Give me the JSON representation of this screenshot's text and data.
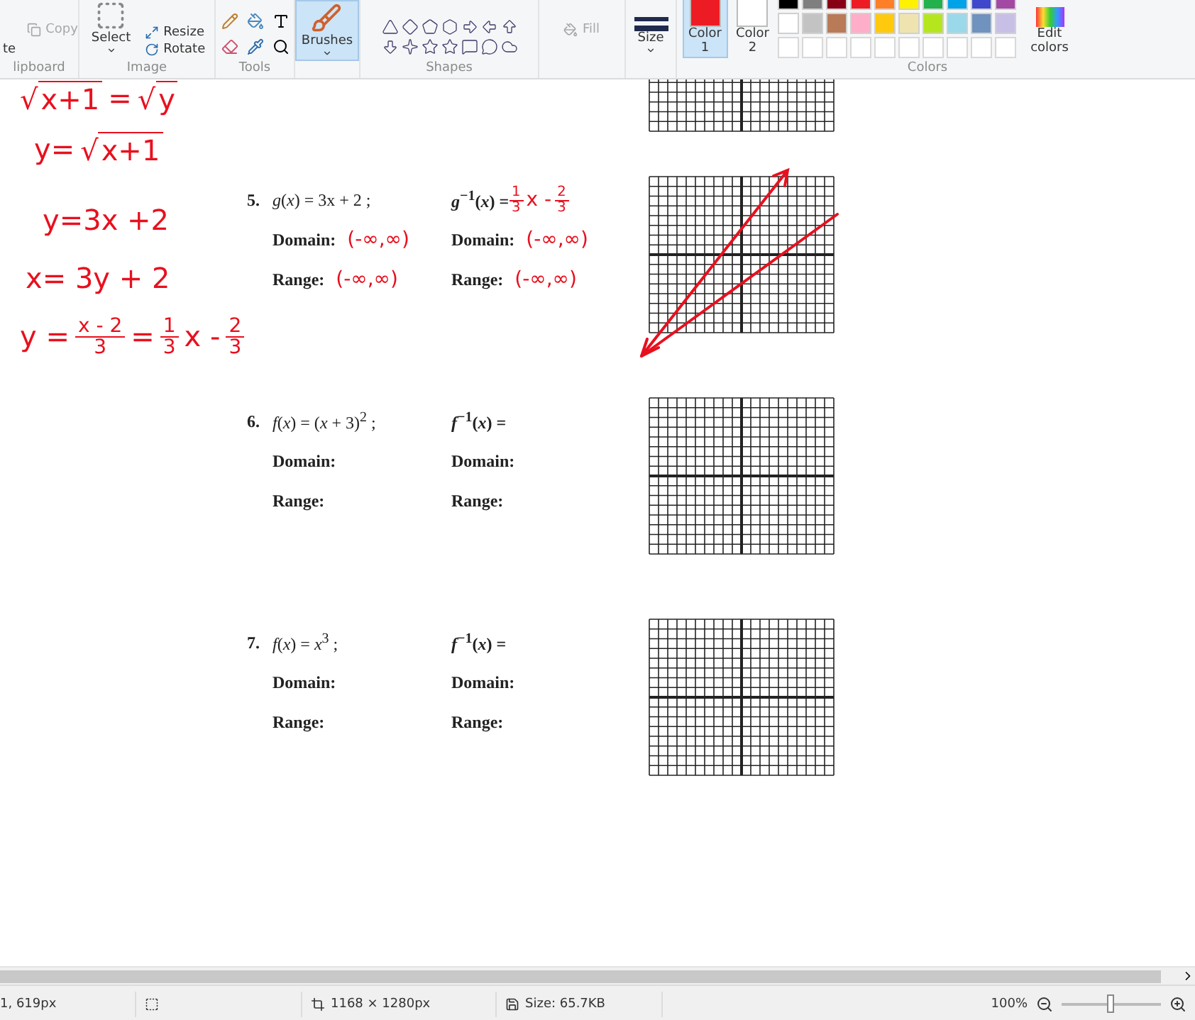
{
  "ribbon": {
    "groups": [
      {
        "kind": "clipboard",
        "label": "lipboard",
        "paste": "te",
        "items": [
          {
            "label": "Copy",
            "disabled": true
          }
        ]
      },
      {
        "kind": "image",
        "label": "Image",
        "select": "Select",
        "items": [
          {
            "label": "Resize",
            "disabled": false
          },
          {
            "label": "Rotate",
            "disabled": false
          }
        ]
      },
      {
        "kind": "tools",
        "label": "Tools"
      },
      {
        "kind": "brushes",
        "label": "Brushes",
        "selected": true
      },
      {
        "kind": "shapes",
        "label": "Shapes"
      },
      {
        "kind": "fill",
        "label": "Fill",
        "disabled": true
      },
      {
        "kind": "size",
        "label": "Size"
      },
      {
        "kind": "slots",
        "slots": [
          {
            "label": "Color",
            "index": "1",
            "selected": true,
            "color": "#ed1c24"
          },
          {
            "label": "Color",
            "index": "2",
            "selected": false,
            "color": "#ffffff"
          }
        ]
      },
      {
        "kind": "palette",
        "label": "Colors",
        "colors": [
          {
            "color": "#000000"
          },
          {
            "color": "#7f7f7f"
          },
          {
            "color": "#880015"
          },
          {
            "color": "#ed1c24"
          },
          {
            "color": "#ff7f27"
          },
          {
            "color": "#fff200"
          },
          {
            "color": "#22b14c"
          },
          {
            "color": "#00a2e8"
          },
          {
            "color": "#3f48cc"
          },
          {
            "color": "#a349a4"
          },
          {
            "color": "#ffffff"
          },
          {
            "color": "#c3c3c3"
          },
          {
            "color": "#b97a57"
          },
          {
            "color": "#ffaec9"
          },
          {
            "color": "#ffc90e"
          },
          {
            "color": "#efe4b0"
          },
          {
            "color": "#b5e61d"
          },
          {
            "color": "#99d9ea"
          },
          {
            "color": "#7092be"
          },
          {
            "color": "#c8bfe7"
          }
        ],
        "edit": "Edit colors"
      }
    ]
  },
  "notes": [
    {
      "parts": [
        {
          "sign": "√",
          "root": "x+1"
        },
        {
          "text": "="
        },
        {
          "sign": "√",
          "root": "y"
        }
      ]
    },
    {
      "parts": [
        {
          "text": "y="
        },
        {
          "sign": "√",
          "root": "x+1"
        }
      ]
    },
    {
      "parts": [
        {
          "text": "y=3x +2"
        }
      ]
    },
    {
      "parts": [
        {
          "text": "x= 3y + 2"
        }
      ]
    },
    {
      "parts": [
        {
          "text": "y ="
        },
        {
          "num": "x - 2",
          "den": "3"
        },
        {
          "text": "="
        },
        {
          "num": "1",
          "den": "3"
        },
        {
          "text": "x -"
        },
        {
          "num": "2",
          "den": "3"
        }
      ]
    }
  ],
  "problems": [
    {
      "number": "5.",
      "function": "*g*(*x*) =  3x + 2 ;",
      "inverse": "*g*$^{−1}$(*x*) =",
      "inverse_answer": [
        {
          "num": "1",
          "den": "3"
        },
        {
          "text": "x -"
        },
        {
          "num": "2",
          "den": "3"
        }
      ],
      "rows": [
        {
          "label": "Domain:",
          "answer": "(-∞,∞)",
          "inverse_label": "Domain:",
          "inverse_answer": "(-∞,∞)"
        },
        {
          "label": "Range:",
          "answer": "(-∞,∞)",
          "inverse_label": "Range:",
          "inverse_answer": "(-∞,∞)"
        }
      ],
      "sketched_lines": true
    },
    {
      "number": "6.",
      "function": "*f*(*x*) =  (*x* + 3)$^{2}$ ;",
      "inverse": "*f*$^{−1}$(*x*) =",
      "rows": [
        {
          "label": "Domain:",
          "inverse_label": "Domain:"
        },
        {
          "label": "Range:",
          "inverse_label": "Range:"
        }
      ],
      "sketched_lines": false
    },
    {
      "number": "7.",
      "function": "*f*(*x*) =  *x*$^{3}$ ;",
      "inverse": "*f*$^{−1}$(*x*) =",
      "rows": [
        {
          "label": "Domain:",
          "inverse_label": "Domain:"
        },
        {
          "label": "Range:",
          "inverse_label": "Range:"
        }
      ],
      "sketched_lines": false
    }
  ],
  "status_bar": {
    "cursor": "1, 619px",
    "dimensions": "1168 × 1280px",
    "size": "Size: 65.7KB",
    "zoom": "100%",
    "zoom_level": {
      "level": 0.5
    }
  }
}
